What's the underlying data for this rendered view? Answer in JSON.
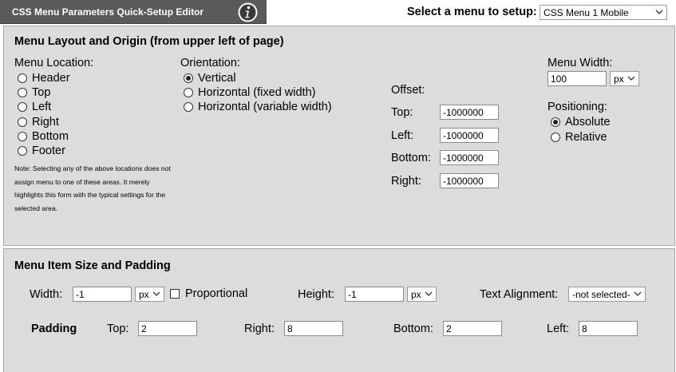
{
  "header": {
    "title": "CSS Menu Parameters Quick-Setup Editor",
    "info_icon": "info-circle-icon",
    "menu_select_label": "Select a menu to setup:",
    "menu_select_value": "CSS Menu 1 Mobile"
  },
  "layout_section": {
    "title": "Menu Layout and Origin (from upper left of page)",
    "location_label": "Menu Location:",
    "locations": [
      "Header",
      "Top",
      "Left",
      "Right",
      "Bottom",
      "Footer"
    ],
    "note": "Note: Selecting any of the above locations does not assign menu to one of these areas. It merely highlights this form with the typical settings for the selected area.",
    "orientation_label": "Orientation:",
    "orientations": [
      "Vertical",
      "Horizontal (fixed width)",
      "Horizontal (variable width)"
    ],
    "offset_label": "Offset:",
    "offset_top_label": "Top:",
    "offset_top_value": "-1000000",
    "offset_left_label": "Left:",
    "offset_left_value": "-1000000",
    "offset_bottom_label": "Bottom:",
    "offset_bottom_value": "-1000000",
    "offset_right_label": "Right:",
    "offset_right_value": "-1000000",
    "width_label": "Menu Width:",
    "width_value": "100",
    "width_unit": "px",
    "positioning_label": "Positioning:",
    "positionings": [
      "Absolute",
      "Relative"
    ]
  },
  "item_section": {
    "title": "Menu Item Size and Padding",
    "width_label": "Width:",
    "width_value": "-1",
    "width_unit": "px",
    "proportional_label": "Proportional",
    "height_label": "Height:",
    "height_value": "-1",
    "height_unit": "px",
    "text_align_label": "Text Alignment:",
    "text_align_value": "-not selected-",
    "padding_label": "Padding",
    "pad_top_label": "Top:",
    "pad_top_value": "2",
    "pad_right_label": "Right:",
    "pad_right_value": "8",
    "pad_bottom_label": "Bottom:",
    "pad_bottom_value": "2",
    "pad_left_label": "Left:",
    "pad_left_value": "8"
  }
}
